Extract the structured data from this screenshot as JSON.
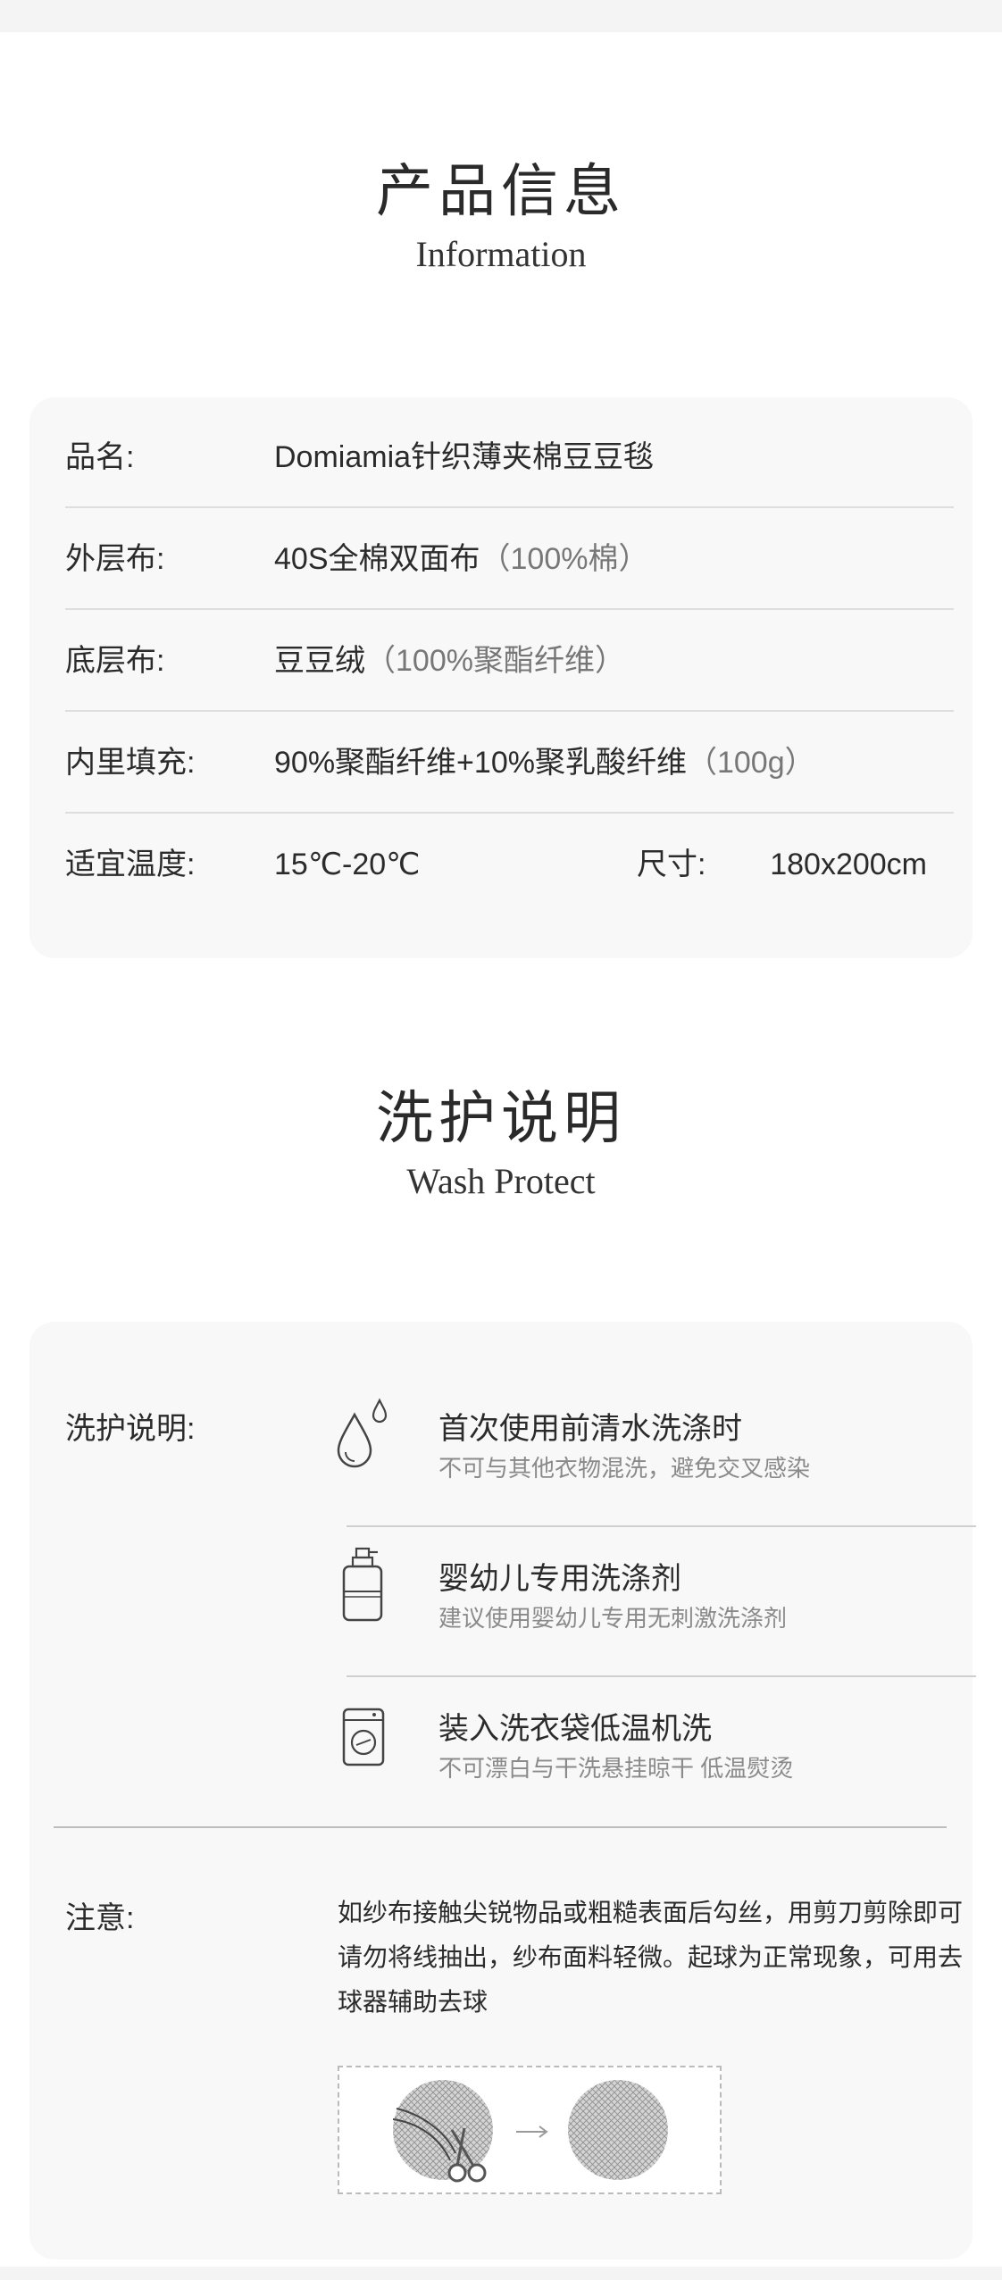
{
  "product_section": {
    "title_cn": "产品信息",
    "title_en": "Information",
    "rows": [
      {
        "label": "品名:",
        "value": "Domiamia针织薄夹棉豆豆毯",
        "note": ""
      },
      {
        "label": "外层布:",
        "value": "40S全棉双面布",
        "note": "（100%棉）"
      },
      {
        "label": "底层布:",
        "value": "豆豆绒",
        "note": "（100%聚酯纤维）"
      },
      {
        "label": "内里填充:",
        "value": "90%聚酯纤维+10%聚乳酸纤维",
        "note": "（100g）"
      }
    ],
    "last_row": {
      "label": "适宜温度:",
      "value": "15℃-20℃",
      "size_label": "尺寸:",
      "size_value": "180x200cm"
    }
  },
  "wash_section": {
    "title_cn": "洗护说明",
    "title_en": "Wash Protect",
    "label": "洗护说明:",
    "items": [
      {
        "icon": "water-drops-icon",
        "title": "首次使用前清水洗涤时",
        "desc": "不可与其他衣物混洗，避免交叉感染"
      },
      {
        "icon": "detergent-bottle-icon",
        "title": "婴幼儿专用洗涤剂",
        "desc": "建议使用婴幼儿专用无刺激洗涤剂"
      },
      {
        "icon": "washing-machine-icon",
        "title": "装入洗衣袋低温机洗",
        "desc": "不可漂白与干洗悬挂晾干 低温熨烫"
      }
    ],
    "notice_label": "注意:",
    "notice_lines": [
      "如纱布接触尖锐物品或粗糙表面后勾丝，用剪刀剪除即可",
      "请勿将线抽出，纱布面料轻微。起球为正常现象，可用去",
      "球器辅助去球"
    ]
  }
}
